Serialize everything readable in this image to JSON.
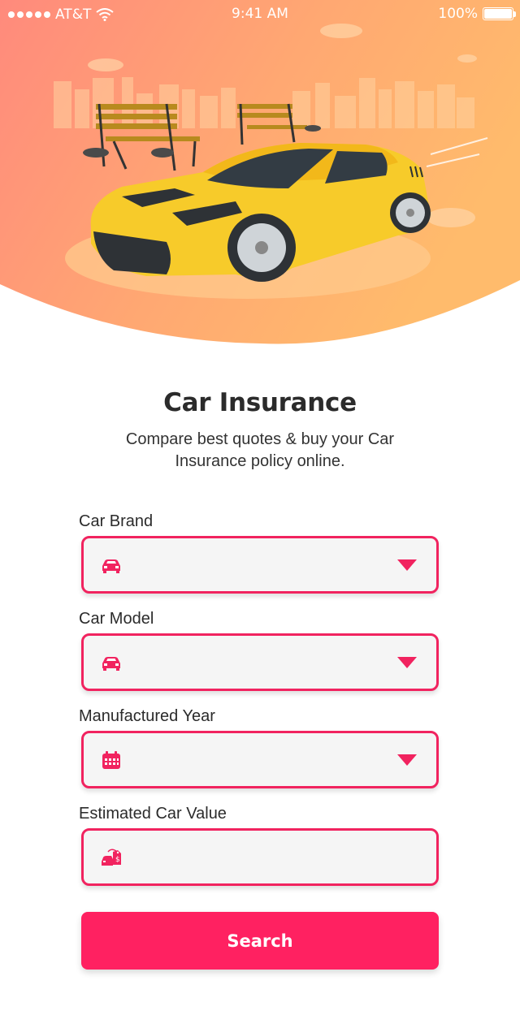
{
  "status_bar": {
    "carrier": "AT&T",
    "time": "9:41 AM",
    "battery": "100%",
    "signal_icon": "signal-dots-icon",
    "wifi_icon": "wifi-icon",
    "battery_icon": "battery-icon"
  },
  "hero": {
    "illustration": "yellow-sports-car-park-benches-illustration"
  },
  "header": {
    "title": "Car Insurance",
    "subtitle": "Compare best quotes & buy your Car Insurance policy online."
  },
  "form": {
    "fields": [
      {
        "label": "Car Brand",
        "value": "",
        "icon": "car-icon",
        "type": "dropdown"
      },
      {
        "label": "Car Model",
        "value": "",
        "icon": "car-icon",
        "type": "dropdown"
      },
      {
        "label": "Manufactured Year",
        "value": "",
        "icon": "calendar-icon",
        "type": "dropdown"
      },
      {
        "label": "Estimated Car Value",
        "value": "",
        "icon": "car-price-tag-icon",
        "type": "input"
      }
    ],
    "search_label": "Search"
  },
  "colors": {
    "accent": "#f1235f",
    "button": "#ff2161",
    "hero_gradient_start": "#ff8a7a",
    "hero_gradient_end": "#ffb86a",
    "car": "#f7cb2a"
  }
}
